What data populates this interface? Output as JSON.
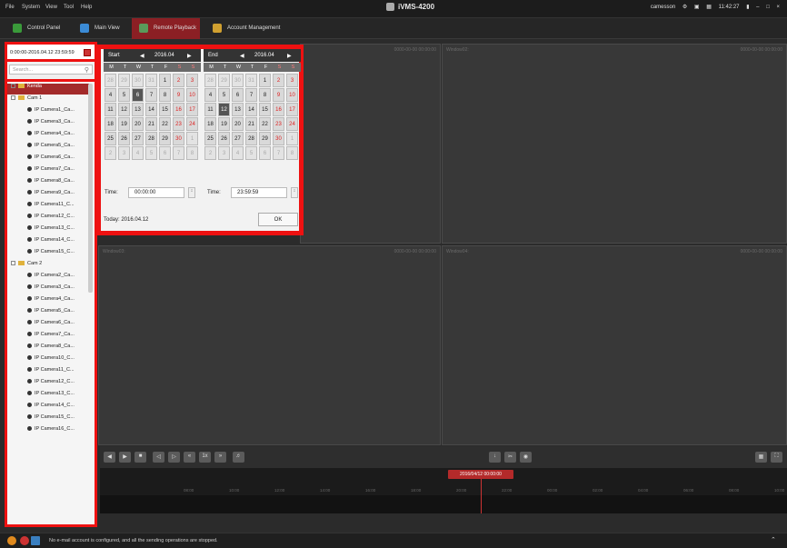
{
  "menu": [
    "File",
    "System",
    "View",
    "Tool",
    "Help"
  ],
  "app_title": "iVMS-4200",
  "system_bar": {
    "user": "camesson",
    "time": "11:42:27"
  },
  "tabs": [
    {
      "label": "Control Panel",
      "active": false,
      "icon": "grid-icon",
      "color": "#3a9a3a"
    },
    {
      "label": "Main View",
      "active": false,
      "icon": "monitor-icon",
      "color": "#3b8bd6"
    },
    {
      "label": "Remote Playback",
      "active": true,
      "icon": "playback-icon",
      "color": "#5a9a5a"
    },
    {
      "label": "Account Management",
      "active": false,
      "icon": "user-icon",
      "color": "#d0a030"
    }
  ],
  "sidebar": {
    "date_range": "0:00:00-2016.04.12 23:59:59",
    "search_placeholder": "Search...",
    "tree_root": "Kenda",
    "groups": [
      {
        "name": "Cam 1",
        "items": [
          "IP Camera1_Ca...",
          "IP Camera3_Ca...",
          "IP Camera4_Ca...",
          "IP Camera5_Ca...",
          "IP Camera6_Ca...",
          "IP Camera7_Ca...",
          "IP Camera8_Ca...",
          "IP Camera9_Ca...",
          "IP Camera11_C...",
          "IP Camera12_C...",
          "IP Camera13_C...",
          "IP Camera14_C...",
          "IP Camera15_C..."
        ]
      },
      {
        "name": "Cam 2",
        "items": [
          "IP Camera2_Ca...",
          "IP Camera3_Ca...",
          "IP Camera4_Ca...",
          "IP Camera5_Ca...",
          "IP Camera6_Ca...",
          "IP Camera7_Ca...",
          "IP Camera8_Ca...",
          "IP Camera10_C...",
          "IP Camera11_C...",
          "IP Camera12_C...",
          "IP Camera13_C...",
          "IP Camera14_C...",
          "IP Camera15_C...",
          "IP Camera16_C..."
        ]
      }
    ]
  },
  "calendar": {
    "start": {
      "label": "Start",
      "month": "2016.04",
      "time": "00:00:00",
      "selected_day": "6"
    },
    "end": {
      "label": "End",
      "month": "2016.04",
      "time": "23:59:59",
      "selected_day": "12"
    },
    "dow": [
      "M",
      "T",
      "W",
      "T",
      "F",
      "S",
      "S"
    ],
    "weeks": [
      [
        "28",
        "29",
        "30",
        "31",
        "1",
        "2",
        "3"
      ],
      [
        "4",
        "5",
        "6",
        "7",
        "8",
        "9",
        "10"
      ],
      [
        "11",
        "12",
        "13",
        "14",
        "15",
        "16",
        "17"
      ],
      [
        "18",
        "19",
        "20",
        "21",
        "22",
        "23",
        "24"
      ],
      [
        "25",
        "26",
        "27",
        "28",
        "29",
        "30",
        "1"
      ],
      [
        "2",
        "3",
        "4",
        "5",
        "6",
        "7",
        "8"
      ]
    ],
    "time_label": "Time:",
    "today": "Today: 2016.04.12",
    "ok": "OK"
  },
  "windows": [
    {
      "name": "Window01:",
      "time": "0000-00-00 00:00:00"
    },
    {
      "name": "Window02:",
      "time": "0000-00-00 00:00:00"
    },
    {
      "name": "Window03:",
      "time": "0000-00-00 00:00:00"
    },
    {
      "name": "Window04:",
      "time": "0000-00-00 00:00:00"
    }
  ],
  "playback": {
    "speed": "1x"
  },
  "timeline": {
    "marker": "2016/04/12 00:00:00",
    "ticks": [
      "08:00",
      "10:00",
      "12:00",
      "14:00",
      "16:00",
      "18:00",
      "20:00",
      "22:00",
      "00:00",
      "02:00",
      "04:00",
      "06:00",
      "08:00",
      "10:00"
    ]
  },
  "status": "No e-mail account is configured, and all the sending operations are stopped."
}
